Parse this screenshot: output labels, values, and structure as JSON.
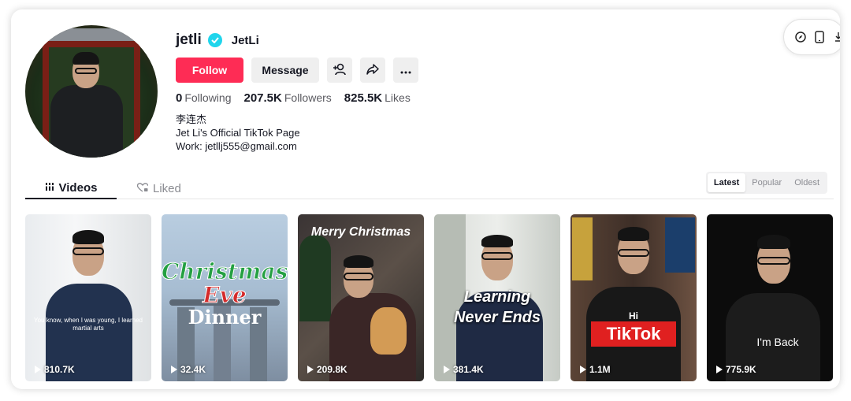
{
  "profile": {
    "username": "jetli",
    "nickname": "JetLi",
    "verified": true,
    "buttons": {
      "follow": "Follow",
      "message": "Message"
    },
    "stats": [
      {
        "value": "0",
        "label": "Following"
      },
      {
        "value": "207.5K",
        "label": "Followers"
      },
      {
        "value": "825.5K",
        "label": "Likes"
      }
    ],
    "bio": [
      "李连杰",
      "Jet Li's Official TikTok Page",
      "Work: jetllj555@gmail.com"
    ]
  },
  "tabs": {
    "videos": "Videos",
    "liked": "Liked"
  },
  "sort_options": [
    "Latest",
    "Popular",
    "Oldest"
  ],
  "sort_selected": "Latest",
  "videos": [
    {
      "views": "810.7K",
      "caption": "You know, when I was young, I learned martial arts"
    },
    {
      "views": "32.4K",
      "overlay": [
        "Christmas",
        "Eve",
        "Dinner"
      ]
    },
    {
      "views": "209.8K",
      "overlay": [
        "Merry Christmas"
      ]
    },
    {
      "views": "381.4K",
      "overlay": [
        "Learning",
        "Never Ends"
      ]
    },
    {
      "views": "1.1M",
      "overlay": [
        "Hi",
        "TikTok"
      ]
    },
    {
      "views": "775.9K",
      "overlay": [
        "I'm Back"
      ]
    }
  ],
  "colors": {
    "accent": "#fe2c55",
    "verified": "#20d5ec"
  },
  "icons": [
    "compass-icon",
    "phone-icon",
    "add-friend-icon",
    "share-icon",
    "more-icon",
    "grid-icon",
    "heart-lock-icon",
    "play-icon",
    "verified-check-icon"
  ]
}
